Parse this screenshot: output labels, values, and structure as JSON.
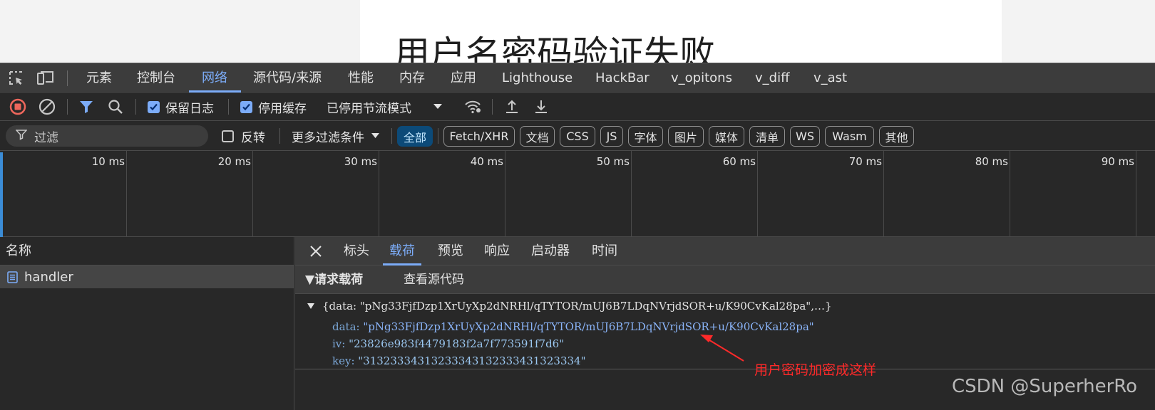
{
  "page": {
    "heading": "用户名密码验证失败"
  },
  "devtools_tabs": [
    "元素",
    "控制台",
    "网络",
    "源代码/来源",
    "性能",
    "内存",
    "应用",
    "Lighthouse",
    "HackBar",
    "v_opitons",
    "v_diff",
    "v_ast"
  ],
  "active_tab": "网络",
  "toolbar": {
    "preserve_log": "保留日志",
    "disable_cache": "停用缓存",
    "throttling": "已停用节流模式"
  },
  "filter": {
    "placeholder": "过滤",
    "invert": "反转",
    "more_filters": "更多过滤条件",
    "types": [
      "全部",
      "Fetch/XHR",
      "文档",
      "CSS",
      "JS",
      "字体",
      "图片",
      "媒体",
      "清单",
      "WS",
      "Wasm",
      "其他"
    ],
    "active_type": "全部"
  },
  "timeline": {
    "ticks": [
      "10 ms",
      "20 ms",
      "30 ms",
      "40 ms",
      "50 ms",
      "60 ms",
      "70 ms",
      "80 ms",
      "90 ms"
    ]
  },
  "request_list": {
    "header": "名称",
    "rows": [
      {
        "name": "handler",
        "selected": true
      }
    ]
  },
  "detail_tabs": [
    "标头",
    "载荷",
    "预览",
    "响应",
    "启动器",
    "时间"
  ],
  "active_detail_tab": "载荷",
  "payload": {
    "section_title": "▼请求载荷",
    "view_source": "查看源代码",
    "summary": "{data: \"pNg33FjfDzp1XrUyXp2dNRHl/qTYTOR/mUJ6B7LDqNVrjdSOR+u/K90CvKal28pa\",…}",
    "fields": [
      {
        "key": "data",
        "value": "\"pNg33FjfDzp1XrUyXp2dNRHl/qTYTOR/mUJ6B7LDqNVrjdSOR+u/K90CvKal28pa\""
      },
      {
        "key": "iv",
        "value": "\"23826e983f4479183f2a7f773591f7d6\""
      },
      {
        "key": "key",
        "value": "\"31323334313233343132333431323334\""
      }
    ]
  },
  "annotation": {
    "text": "用户密码加密成这样",
    "color": "#ff2a2a"
  },
  "watermark": "CSDN @SuperherRo",
  "colors": {
    "accent": "#7cacf8",
    "panel": "#282828",
    "tabbar": "#3c3c3c",
    "chip_active": "#0c4a78"
  }
}
